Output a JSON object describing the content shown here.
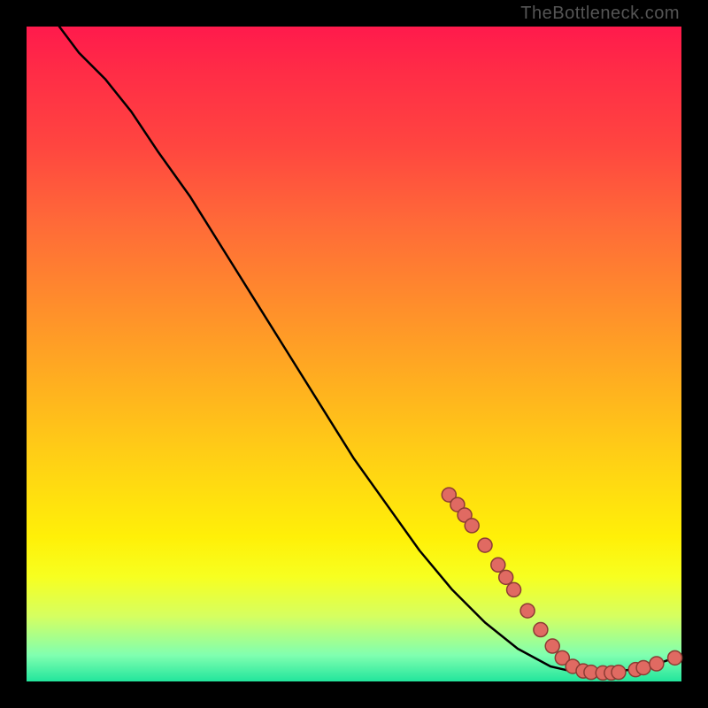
{
  "attribution": "TheBottleneck.com",
  "chart_data": {
    "type": "line",
    "title": "",
    "xlabel": "",
    "ylabel": "",
    "xlim": [
      0,
      100
    ],
    "ylim": [
      0,
      100
    ],
    "grid": false,
    "series": [
      {
        "name": "curve",
        "stroke": "#000000",
        "points": [
          {
            "x": 5,
            "y": 100
          },
          {
            "x": 8,
            "y": 96
          },
          {
            "x": 12,
            "y": 92
          },
          {
            "x": 16,
            "y": 87
          },
          {
            "x": 20,
            "y": 81
          },
          {
            "x": 25,
            "y": 74
          },
          {
            "x": 30,
            "y": 66
          },
          {
            "x": 35,
            "y": 58
          },
          {
            "x": 40,
            "y": 50
          },
          {
            "x": 45,
            "y": 42
          },
          {
            "x": 50,
            "y": 34
          },
          {
            "x": 55,
            "y": 27
          },
          {
            "x": 60,
            "y": 20
          },
          {
            "x": 65,
            "y": 14
          },
          {
            "x": 70,
            "y": 9
          },
          {
            "x": 75,
            "y": 5
          },
          {
            "x": 80,
            "y": 2.3
          },
          {
            "x": 83,
            "y": 1.6
          },
          {
            "x": 86,
            "y": 1.3
          },
          {
            "x": 90,
            "y": 1.5
          },
          {
            "x": 93,
            "y": 1.9
          },
          {
            "x": 96,
            "y": 2.6
          },
          {
            "x": 99,
            "y": 3.6
          }
        ]
      },
      {
        "name": "markers",
        "marker_fill": "#e06a62",
        "marker_stroke": "#8c3c34",
        "marker_r": 8,
        "points": [
          {
            "x": 64.5,
            "y": 28.5
          },
          {
            "x": 65.8,
            "y": 27.0
          },
          {
            "x": 66.9,
            "y": 25.4
          },
          {
            "x": 68.0,
            "y": 23.8
          },
          {
            "x": 70.0,
            "y": 20.8
          },
          {
            "x": 72.0,
            "y": 17.8
          },
          {
            "x": 73.2,
            "y": 15.9
          },
          {
            "x": 74.4,
            "y": 14.0
          },
          {
            "x": 76.5,
            "y": 10.8
          },
          {
            "x": 78.5,
            "y": 7.9
          },
          {
            "x": 80.3,
            "y": 5.4
          },
          {
            "x": 81.8,
            "y": 3.6
          },
          {
            "x": 83.4,
            "y": 2.3
          },
          {
            "x": 85.0,
            "y": 1.6
          },
          {
            "x": 86.2,
            "y": 1.4
          },
          {
            "x": 88.0,
            "y": 1.3
          },
          {
            "x": 89.3,
            "y": 1.3
          },
          {
            "x": 90.4,
            "y": 1.4
          },
          {
            "x": 93.0,
            "y": 1.8
          },
          {
            "x": 94.2,
            "y": 2.1
          },
          {
            "x": 96.2,
            "y": 2.7
          },
          {
            "x": 99.0,
            "y": 3.6
          }
        ]
      }
    ]
  }
}
